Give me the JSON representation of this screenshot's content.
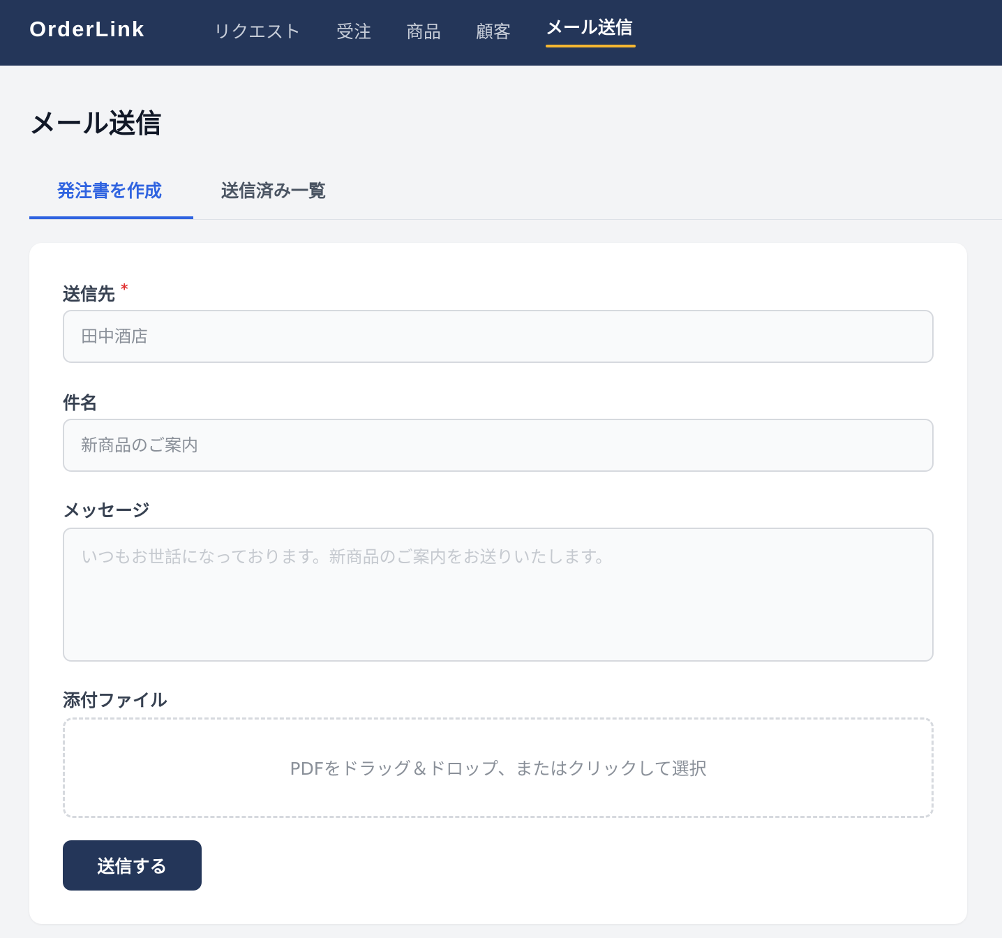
{
  "app": {
    "brand": "OrderLink"
  },
  "nav": {
    "items": [
      {
        "label": "リクエスト"
      },
      {
        "label": "受注"
      },
      {
        "label": "商品"
      },
      {
        "label": "顧客"
      },
      {
        "label": "メール送信",
        "active": true
      }
    ]
  },
  "page": {
    "title": "メール送信"
  },
  "tabs": [
    {
      "label": "発注書を作成",
      "active": true
    },
    {
      "label": "送信済み一覧",
      "active": false
    }
  ],
  "form": {
    "recipient": {
      "label": "送信先",
      "required_mark": "*",
      "placeholder": "田中酒店",
      "value": ""
    },
    "subject": {
      "label": "件名",
      "placeholder": "新商品のご案内",
      "value": ""
    },
    "message": {
      "label": "メッセージ",
      "placeholder": "いつもお世話になっております。新商品のご案内をお送りいたします。",
      "value": ""
    },
    "attachment": {
      "label": "添付ファイル",
      "dropzone_text": "PDFをドラッグ＆ドロップ、またはクリックして選択"
    },
    "submit_label": "送信する"
  },
  "colors": {
    "header_bg": "#243659",
    "nav_accent": "#f5b731",
    "tab_accent": "#2f63e0",
    "required": "#e03131"
  }
}
